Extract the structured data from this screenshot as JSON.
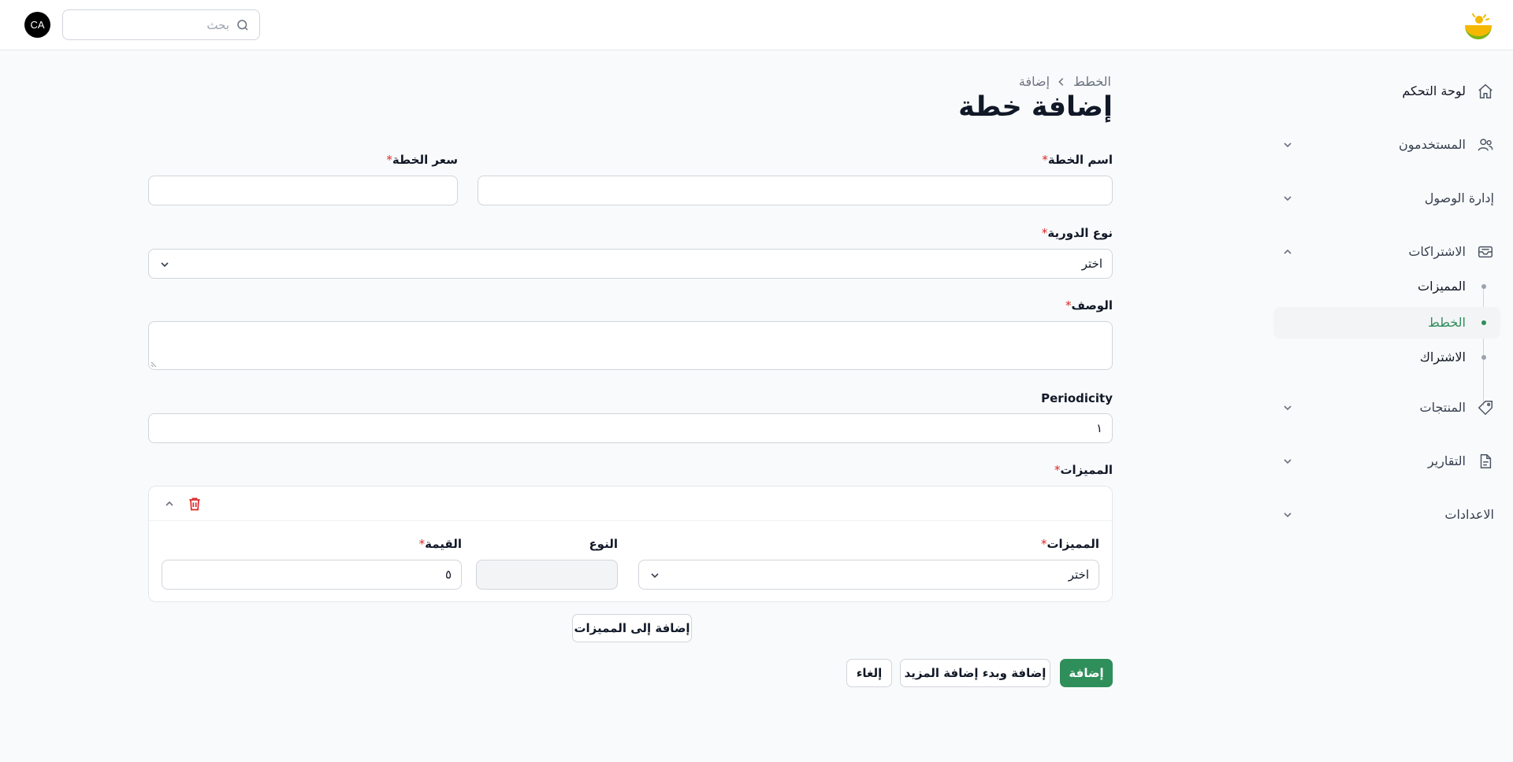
{
  "header": {
    "avatar_initials": "CA",
    "search_placeholder": "بحث",
    "logo_icon": "logo-sun-bowl-icon"
  },
  "sidebar": {
    "items": [
      {
        "label": "لوحة التحكم",
        "icon": "home-icon"
      },
      {
        "label": "المستخدمون",
        "icon": "users-icon"
      },
      {
        "label": "إدارة الوصول"
      },
      {
        "label": "الاشتراكات",
        "icon": "inbox-icon"
      },
      {
        "label": "المنتجات",
        "icon": "tag-icon"
      },
      {
        "label": "التقارير",
        "icon": "document-icon"
      },
      {
        "label": "الاعدادات"
      }
    ],
    "subscriptions_sub": [
      {
        "label": "المميزات"
      },
      {
        "label": "الخطط"
      },
      {
        "label": "الاشتراك"
      }
    ],
    "active_sub": "الخطط"
  },
  "breadcrumb": {
    "parent": "الخطط",
    "current": "إضافة"
  },
  "page_title": "إضافة خطة",
  "form": {
    "plan_name_label": "اسم الخطة",
    "plan_price_label": "سعر الخطة",
    "periodicity_type_label": "نوع الدورية",
    "periodicity_type_value": "اختر",
    "description_label": "الوصف",
    "periodicity_label": "Periodicity",
    "periodicity_value": "١",
    "features_label": "المميزات",
    "feature_row": {
      "feature_label": "المميزات",
      "feature_value": "اختر",
      "type_label": "النوع",
      "value_label": "القيمة",
      "value_value": "٥"
    },
    "add_feature_button": "إضافة إلى المميزات"
  },
  "actions": {
    "add": "إضافة",
    "add_and_more": "إضافة وبدء إضافة المزيد",
    "cancel": "إلغاء"
  },
  "colors": {
    "primary": "#2f8f5b",
    "danger": "#dc2626",
    "logo_yellow": "#f5b800",
    "logo_green": "#7cb518"
  }
}
